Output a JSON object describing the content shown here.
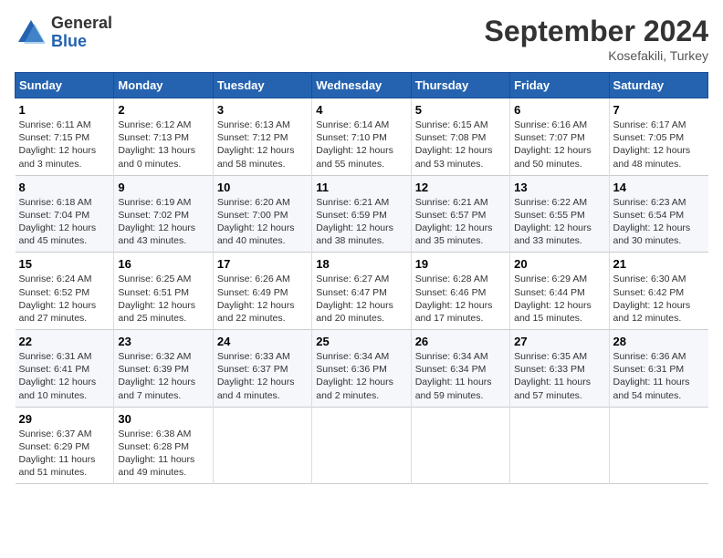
{
  "header": {
    "logo_line1": "General",
    "logo_line2": "Blue",
    "month": "September 2024",
    "location": "Kosefakili, Turkey"
  },
  "weekdays": [
    "Sunday",
    "Monday",
    "Tuesday",
    "Wednesday",
    "Thursday",
    "Friday",
    "Saturday"
  ],
  "weeks": [
    [
      {
        "day": "1",
        "info": "Sunrise: 6:11 AM\nSunset: 7:15 PM\nDaylight: 12 hours\nand 3 minutes."
      },
      {
        "day": "2",
        "info": "Sunrise: 6:12 AM\nSunset: 7:13 PM\nDaylight: 13 hours\nand 0 minutes."
      },
      {
        "day": "3",
        "info": "Sunrise: 6:13 AM\nSunset: 7:12 PM\nDaylight: 12 hours\nand 58 minutes."
      },
      {
        "day": "4",
        "info": "Sunrise: 6:14 AM\nSunset: 7:10 PM\nDaylight: 12 hours\nand 55 minutes."
      },
      {
        "day": "5",
        "info": "Sunrise: 6:15 AM\nSunset: 7:08 PM\nDaylight: 12 hours\nand 53 minutes."
      },
      {
        "day": "6",
        "info": "Sunrise: 6:16 AM\nSunset: 7:07 PM\nDaylight: 12 hours\nand 50 minutes."
      },
      {
        "day": "7",
        "info": "Sunrise: 6:17 AM\nSunset: 7:05 PM\nDaylight: 12 hours\nand 48 minutes."
      }
    ],
    [
      {
        "day": "8",
        "info": "Sunrise: 6:18 AM\nSunset: 7:04 PM\nDaylight: 12 hours\nand 45 minutes."
      },
      {
        "day": "9",
        "info": "Sunrise: 6:19 AM\nSunset: 7:02 PM\nDaylight: 12 hours\nand 43 minutes."
      },
      {
        "day": "10",
        "info": "Sunrise: 6:20 AM\nSunset: 7:00 PM\nDaylight: 12 hours\nand 40 minutes."
      },
      {
        "day": "11",
        "info": "Sunrise: 6:21 AM\nSunset: 6:59 PM\nDaylight: 12 hours\nand 38 minutes."
      },
      {
        "day": "12",
        "info": "Sunrise: 6:21 AM\nSunset: 6:57 PM\nDaylight: 12 hours\nand 35 minutes."
      },
      {
        "day": "13",
        "info": "Sunrise: 6:22 AM\nSunset: 6:55 PM\nDaylight: 12 hours\nand 33 minutes."
      },
      {
        "day": "14",
        "info": "Sunrise: 6:23 AM\nSunset: 6:54 PM\nDaylight: 12 hours\nand 30 minutes."
      }
    ],
    [
      {
        "day": "15",
        "info": "Sunrise: 6:24 AM\nSunset: 6:52 PM\nDaylight: 12 hours\nand 27 minutes."
      },
      {
        "day": "16",
        "info": "Sunrise: 6:25 AM\nSunset: 6:51 PM\nDaylight: 12 hours\nand 25 minutes."
      },
      {
        "day": "17",
        "info": "Sunrise: 6:26 AM\nSunset: 6:49 PM\nDaylight: 12 hours\nand 22 minutes."
      },
      {
        "day": "18",
        "info": "Sunrise: 6:27 AM\nSunset: 6:47 PM\nDaylight: 12 hours\nand 20 minutes."
      },
      {
        "day": "19",
        "info": "Sunrise: 6:28 AM\nSunset: 6:46 PM\nDaylight: 12 hours\nand 17 minutes."
      },
      {
        "day": "20",
        "info": "Sunrise: 6:29 AM\nSunset: 6:44 PM\nDaylight: 12 hours\nand 15 minutes."
      },
      {
        "day": "21",
        "info": "Sunrise: 6:30 AM\nSunset: 6:42 PM\nDaylight: 12 hours\nand 12 minutes."
      }
    ],
    [
      {
        "day": "22",
        "info": "Sunrise: 6:31 AM\nSunset: 6:41 PM\nDaylight: 12 hours\nand 10 minutes."
      },
      {
        "day": "23",
        "info": "Sunrise: 6:32 AM\nSunset: 6:39 PM\nDaylight: 12 hours\nand 7 minutes."
      },
      {
        "day": "24",
        "info": "Sunrise: 6:33 AM\nSunset: 6:37 PM\nDaylight: 12 hours\nand 4 minutes."
      },
      {
        "day": "25",
        "info": "Sunrise: 6:34 AM\nSunset: 6:36 PM\nDaylight: 12 hours\nand 2 minutes."
      },
      {
        "day": "26",
        "info": "Sunrise: 6:34 AM\nSunset: 6:34 PM\nDaylight: 11 hours\nand 59 minutes."
      },
      {
        "day": "27",
        "info": "Sunrise: 6:35 AM\nSunset: 6:33 PM\nDaylight: 11 hours\nand 57 minutes."
      },
      {
        "day": "28",
        "info": "Sunrise: 6:36 AM\nSunset: 6:31 PM\nDaylight: 11 hours\nand 54 minutes."
      }
    ],
    [
      {
        "day": "29",
        "info": "Sunrise: 6:37 AM\nSunset: 6:29 PM\nDaylight: 11 hours\nand 51 minutes."
      },
      {
        "day": "30",
        "info": "Sunrise: 6:38 AM\nSunset: 6:28 PM\nDaylight: 11 hours\nand 49 minutes."
      },
      null,
      null,
      null,
      null,
      null
    ]
  ]
}
